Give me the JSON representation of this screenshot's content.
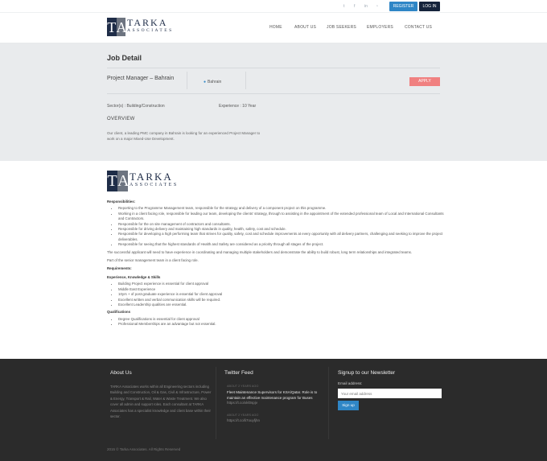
{
  "topbar": {
    "social_icons": [
      "twitter-icon",
      "facebook-icon",
      "linkedin-icon",
      "rss-icon"
    ],
    "register_label": "REGISTER",
    "login_label": "LOG IN"
  },
  "brand": {
    "logo_letters": [
      "T",
      "A"
    ],
    "logo_word": "TARKA",
    "logo_sub": "ASSOCIATES"
  },
  "nav": {
    "items": [
      {
        "label": "HOME"
      },
      {
        "label": "ABOUT US"
      },
      {
        "label": "JOB SEEKERS"
      },
      {
        "label": "EMPLOYERS"
      },
      {
        "label": "CONTACT US"
      }
    ]
  },
  "job": {
    "heading": "Job Detail",
    "role": "Project Manager – Bahrain",
    "location": "Bahrain",
    "apply_label": "APPLY",
    "sector": "Sector(s) : Building/Construction",
    "experience": "Experience : 10 Year",
    "overview_heading": "OVERVIEW",
    "overview_text": "Our client, a leading PMC company in Bahrain is looking for an experienced Project Manager to work on a major Mixed-Use Development."
  },
  "details": {
    "responsibilities_heading": "Responsibilities:",
    "responsibilities": [
      "Reporting to the Programme Management team, responsible for the strategy and delivery of a component project on this programme.",
      "Working in a client facing role, responsible for leading our team, developing the clients' strategy, through to assisting in the appointment of the extended professional team of Local and International Consultants and Contractors.",
      "Responsible for the on site management of contractors and consultants.",
      "Responsible for driving delivery and maintaining high standards in quality, health, safety, cost and schedule.",
      "Responsible for developing a high performing team that strives for quality, safety, cost and schedule improvements at every opportunity with all delivery partners, challenging and seeking to improve the project deliverables.",
      "Responsible for seeing that the highest standards of Health and Safety are considered as a priority through all stages of the project."
    ],
    "para1": "The successful applicant will need to have experience in coordinating and managing multiple stakeholders and demonstrate the ability to build robust, long term relationships and integrated teams.",
    "para2": "Part of the senior management team in a client facing role.",
    "requirements_heading": "Requirements:",
    "experience_heading": "Experience, Knowledge & Skills",
    "experience_items": [
      "Building Project experience is essential for client approval",
      "Middle East Experience",
      "10yrs + of post-graduate experience is essential for client approval",
      "Excellent written and verbal communication skills will be required.",
      "Excellent Leadership qualities are essential."
    ],
    "qualifications_heading": "Qualifications",
    "qualification_items": [
      "Degree Qualifications is essential for client approval",
      "Professional Memberships are an advantage but not essential."
    ]
  },
  "footer": {
    "about_heading": "About Us",
    "about_text": "TARKA Associates works within all Engineering sectors including Building and Construction, Oil & Gas, Civil & Infrastructure, Power & Energy, Transport & Rail, Water & Waste Treatment. We also cover all admin and support roles. Each consultant at TARKA Associates has a specialist knowledge and client base within their sector.",
    "twitter_heading": "Twitter Feed",
    "tweets": [
      {
        "meta": "ABOUT 2 YEARS AGO",
        "text": "Fleet Maintenance Supervisors for KSA/Qatar. Role is to maintain an effective maintenance program for Buses",
        "link": "https://t.co/xkl0spjv"
      },
      {
        "meta": "ABOUT 2 YEARS AGO",
        "text": "",
        "link": "https://t.co/li7ouyfjhn"
      }
    ],
    "newsletter_heading": "Signup to our Newsletter",
    "email_label": "Email address:",
    "email_placeholder": "Your email address",
    "signup_label": "Sign up",
    "copyright": "2015 © Tarka Associates. All Rights Reserved"
  }
}
